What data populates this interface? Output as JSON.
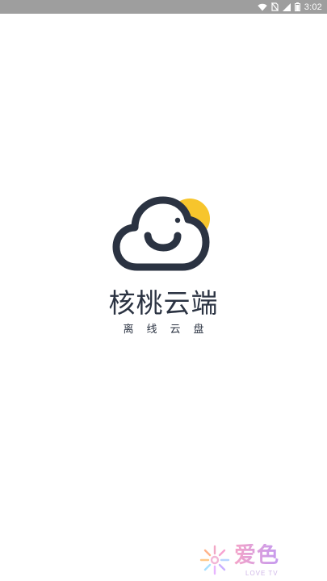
{
  "status_bar": {
    "time": "3:02",
    "icons": [
      "wifi-icon",
      "no-sim-icon",
      "signal-icon",
      "battery-icon"
    ]
  },
  "splash": {
    "app_name": "核桃云端",
    "tagline": "离线云盘",
    "logo_icon": "cloud-smile-icon"
  },
  "watermark": {
    "text": "爱色",
    "subtext": "LOVE TV",
    "icon": "snowflake-icon"
  },
  "colors": {
    "status_bar_bg": "#9e9e9e",
    "logo_dark": "#2b3342",
    "logo_sun": "#f7c52c",
    "background": "#ffffff"
  }
}
